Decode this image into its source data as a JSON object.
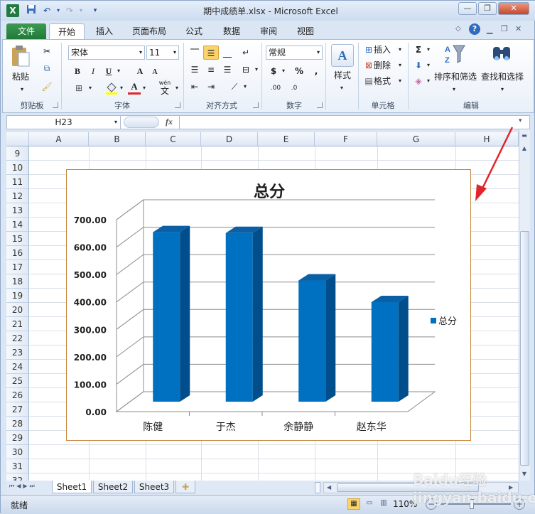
{
  "window": {
    "title": "期中成绩单.xlsx - Microsoft Excel",
    "app_icon": "X",
    "controls": [
      "—",
      "❐",
      "✕"
    ]
  },
  "tabs": [
    {
      "label": "文件"
    },
    {
      "label": "开始"
    },
    {
      "label": "插入"
    },
    {
      "label": "页面布局"
    },
    {
      "label": "公式"
    },
    {
      "label": "数据"
    },
    {
      "label": "审阅"
    },
    {
      "label": "视图"
    }
  ],
  "ribbon": {
    "clipboard": {
      "paste": "粘贴",
      "label": "剪贴板"
    },
    "font": {
      "name": "宋体",
      "size": "11",
      "label": "字体",
      "bold": "B",
      "italic": "I",
      "underline": "U",
      "grow": "A",
      "shrink": "A",
      "phonetic": "wén",
      "phonetic_char": "文"
    },
    "alignment": {
      "label": "对齐方式"
    },
    "number": {
      "format": "常规",
      "currency": "$",
      "percent": "%",
      "comma": ",",
      "inc": ".00",
      "dec": ".0",
      "label": "数字"
    },
    "styles": {
      "label": "样式"
    },
    "cells": {
      "insert": "插入",
      "delete": "删除",
      "format": "格式",
      "label": "单元格"
    },
    "editing": {
      "sum": "Σ",
      "sort": "排序和筛选",
      "find": "查找和选择",
      "label": "编辑"
    }
  },
  "formula_bar": {
    "name_box": "H23",
    "fx": "fx",
    "value": ""
  },
  "grid": {
    "columns": [
      "A",
      "B",
      "C",
      "D",
      "E",
      "F",
      "G",
      "H"
    ],
    "rows": [
      "9",
      "10",
      "11",
      "12",
      "13",
      "14",
      "15",
      "16",
      "17",
      "18",
      "19",
      "20",
      "21",
      "22",
      "23",
      "24",
      "25",
      "26",
      "27",
      "28",
      "29",
      "30",
      "31",
      "32"
    ]
  },
  "chart_data": {
    "type": "bar",
    "title": "总分",
    "categories": [
      "陈健",
      "于杰",
      "余静静",
      "赵东华"
    ],
    "series": [
      {
        "name": "总分",
        "values": [
          618,
          615,
          442,
          363
        ],
        "color": "#0070c0"
      }
    ],
    "ylim": [
      0,
      700
    ],
    "yticks": [
      "0.00",
      "100.00",
      "200.00",
      "300.00",
      "400.00",
      "500.00",
      "600.00",
      "700.00"
    ],
    "legend": "right",
    "style": "3d-column"
  },
  "sheets": [
    {
      "name": "Sheet1",
      "active": true
    },
    {
      "name": "Sheet2"
    },
    {
      "name": "Sheet3"
    }
  ],
  "status": {
    "ready": "就绪",
    "zoom": "110%"
  },
  "watermark": "Baidu经验 jingyan.baidu.com",
  "colors": {
    "accent": "#1f7a39",
    "bar": "#0070c0",
    "chart_border": "#c7843a",
    "arrow": "#e0262c"
  }
}
